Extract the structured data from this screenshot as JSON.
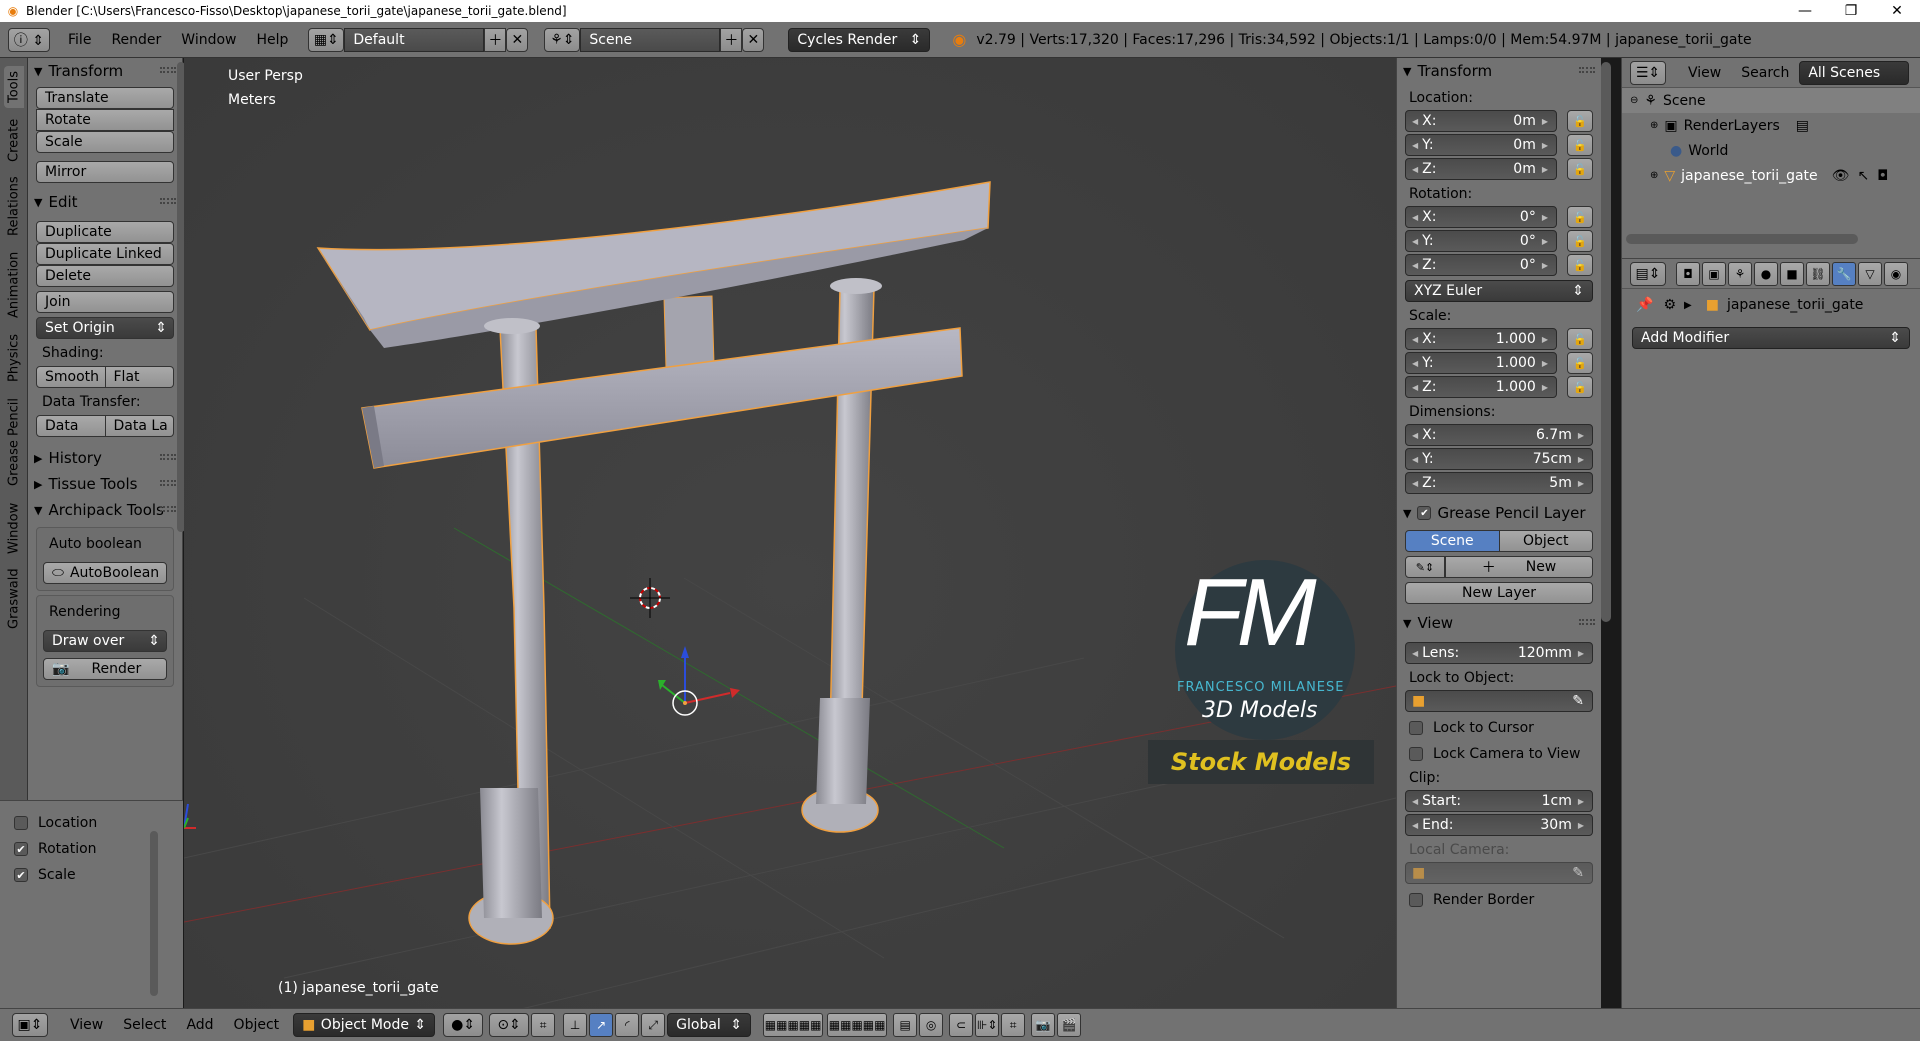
{
  "window": {
    "title": "Blender  [C:\\Users\\Francesco-Fisso\\Desktop\\japanese_torii_gate\\japanese_torii_gate.blend]",
    "minimize": "—",
    "maximize": "❐",
    "close": "✕"
  },
  "info_header": {
    "menus": [
      "File",
      "Render",
      "Window",
      "Help"
    ],
    "screen_layout": "Default",
    "scene": "Scene",
    "engine": "Cycles Render",
    "stats": "v2.79 | Verts:17,320 | Faces:17,296 | Tris:34,592 | Objects:1/1 | Lamps:0/0 | Mem:54.97M | japanese_torii_gate"
  },
  "side_tabs": [
    "Tools",
    "Create",
    "Relations",
    "Animation",
    "Physics",
    "Grease Pencil",
    "Window",
    "Graswald"
  ],
  "tool_shelf": {
    "transform": {
      "title": "Transform",
      "buttons": [
        "Translate",
        "Rotate",
        "Scale"
      ],
      "mirror": "Mirror"
    },
    "edit": {
      "title": "Edit",
      "buttons": [
        "Duplicate",
        "Duplicate Linked",
        "Delete"
      ],
      "join": "Join",
      "set_origin": "Set Origin",
      "shading_label": "Shading:",
      "smooth": "Smooth",
      "flat": "Flat",
      "data_transfer_label": "Data Transfer:",
      "data": "Data",
      "data_la": "Data La"
    },
    "history": "History",
    "tissue": "Tissue Tools",
    "archipack": {
      "title": "Archipack Tools",
      "auto_boolean_label": "Auto boolean",
      "auto_boolean_btn": "AutoBoolean",
      "rendering_label": "Rendering",
      "draw_over": "Draw over",
      "render": "Render"
    }
  },
  "keyframe_panel": {
    "location": "Location",
    "rotation": "Rotation",
    "scale": "Scale"
  },
  "viewport": {
    "view_name": "User Persp",
    "units": "Meters",
    "object_label": "(1) japanese_torii_gate",
    "watermark": {
      "initials": "FM",
      "name": "FRANCESCO MILANESE",
      "sub": "3D Models",
      "stock": "Stock Models"
    }
  },
  "n_panel": {
    "transform_title": "Transform",
    "location_label": "Location:",
    "location": [
      {
        "axis": "X:",
        "value": "0m"
      },
      {
        "axis": "Y:",
        "value": "0m"
      },
      {
        "axis": "Z:",
        "value": "0m"
      }
    ],
    "rotation_label": "Rotation:",
    "rotation": [
      {
        "axis": "X:",
        "value": "0°"
      },
      {
        "axis": "Y:",
        "value": "0°"
      },
      {
        "axis": "Z:",
        "value": "0°"
      }
    ],
    "rotation_mode": "XYZ Euler",
    "scale_label": "Scale:",
    "scale": [
      {
        "axis": "X:",
        "value": "1.000"
      },
      {
        "axis": "Y:",
        "value": "1.000"
      },
      {
        "axis": "Z:",
        "value": "1.000"
      }
    ],
    "dimensions_label": "Dimensions:",
    "dimensions": [
      {
        "axis": "X:",
        "value": "6.7m"
      },
      {
        "axis": "Y:",
        "value": "75cm"
      },
      {
        "axis": "Z:",
        "value": "5m"
      }
    ],
    "gp_title": "Grease Pencil Layer",
    "gp_scene": "Scene",
    "gp_object": "Object",
    "gp_new": "New",
    "gp_new_layer": "New Layer",
    "view_title": "View",
    "lens_label": "Lens:",
    "lens_value": "120mm",
    "lock_to_object": "Lock to Object:",
    "lock_cursor": "Lock to Cursor",
    "lock_camera": "Lock Camera to View",
    "clip_label": "Clip:",
    "clip_start_label": "Start:",
    "clip_start": "1cm",
    "clip_end_label": "End:",
    "clip_end": "30m",
    "local_camera": "Local Camera:",
    "render_border": "Render Border"
  },
  "outliner": {
    "view": "View",
    "search": "Search",
    "filter": "All Scenes",
    "items": [
      "Scene",
      "RenderLayers",
      "World",
      "japanese_torii_gate"
    ]
  },
  "properties": {
    "object_name": "japanese_torii_gate",
    "add_modifier": "Add Modifier"
  },
  "bottom_bar": {
    "view": "View",
    "select": "Select",
    "add": "Add",
    "object": "Object",
    "mode": "Object Mode",
    "orientation": "Global"
  },
  "colors": {
    "panel": "#727272",
    "viewport": "#3d3d3d",
    "selected_outline": "#f0a040",
    "active_blue": "#5680c2"
  }
}
